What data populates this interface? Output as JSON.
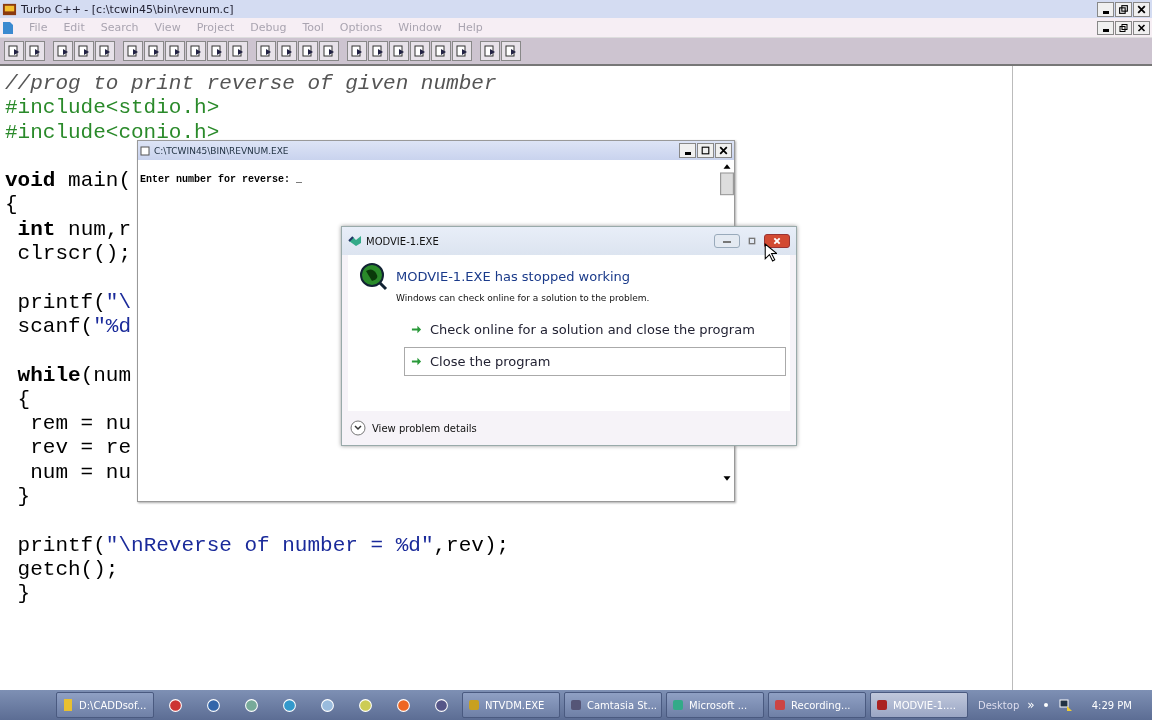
{
  "window": {
    "title": "Turbo C++ - [c:\\tcwin45\\bin\\revnum.c]"
  },
  "menu": [
    {
      "label": "File",
      "disabled": true
    },
    {
      "label": "Edit",
      "disabled": true
    },
    {
      "label": "Search",
      "disabled": true
    },
    {
      "label": "View",
      "disabled": true
    },
    {
      "label": "Project",
      "disabled": true
    },
    {
      "label": "Debug",
      "disabled": true
    },
    {
      "label": "Tool",
      "disabled": true
    },
    {
      "label": "Options",
      "disabled": true
    },
    {
      "label": "Window",
      "disabled": true
    },
    {
      "label": "Help",
      "disabled": true
    }
  ],
  "code": [
    {
      "gap_before": false,
      "segments": [
        {
          "kind": "comment",
          "text": "//prog to print reverse of given number"
        }
      ]
    },
    {
      "gap_before": false,
      "segments": [
        {
          "kind": "directive",
          "text": "#include<stdio.h>"
        }
      ]
    },
    {
      "gap_before": false,
      "segments": [
        {
          "kind": "directive",
          "text": "#include<conio.h>"
        }
      ]
    },
    {
      "gap_before": true,
      "segments": [
        {
          "kind": "keyword",
          "text": "void"
        },
        {
          "kind": "plain",
          "text": " main("
        }
      ]
    },
    {
      "gap_before": false,
      "segments": [
        {
          "kind": "plain",
          "text": "{"
        }
      ]
    },
    {
      "gap_before": false,
      "segments": [
        {
          "kind": "keyword",
          "text": " int"
        },
        {
          "kind": "plain",
          "text": " num,r"
        }
      ]
    },
    {
      "gap_before": false,
      "segments": [
        {
          "kind": "plain",
          "text": " clrscr();"
        }
      ]
    },
    {
      "gap_before": true,
      "segments": [
        {
          "kind": "plain",
          "text": " printf("
        },
        {
          "kind": "string",
          "text": "\"\\"
        }
      ]
    },
    {
      "gap_before": false,
      "segments": [
        {
          "kind": "plain",
          "text": " scanf("
        },
        {
          "kind": "string",
          "text": "\"%d"
        }
      ]
    },
    {
      "gap_before": true,
      "segments": [
        {
          "kind": "keyword",
          "text": " while"
        },
        {
          "kind": "plain",
          "text": "(num"
        }
      ]
    },
    {
      "gap_before": false,
      "segments": [
        {
          "kind": "plain",
          "text": " {"
        }
      ]
    },
    {
      "gap_before": false,
      "segments": [
        {
          "kind": "plain",
          "text": "  rem = nu"
        }
      ]
    },
    {
      "gap_before": false,
      "segments": [
        {
          "kind": "plain",
          "text": "  rev = re"
        }
      ]
    },
    {
      "gap_before": false,
      "segments": [
        {
          "kind": "plain",
          "text": "  num = nu"
        }
      ]
    },
    {
      "gap_before": false,
      "segments": [
        {
          "kind": "plain",
          "text": " }"
        }
      ]
    },
    {
      "gap_before": true,
      "segments": [
        {
          "kind": "plain",
          "text": " printf("
        },
        {
          "kind": "string",
          "text": "\"\\nReverse of number = %d\""
        },
        {
          "kind": "plain",
          "text": ",rev);"
        }
      ]
    },
    {
      "gap_before": false,
      "segments": [
        {
          "kind": "plain",
          "text": " getch();"
        }
      ]
    },
    {
      "gap_before": false,
      "segments": [
        {
          "kind": "plain",
          "text": " }"
        }
      ]
    }
  ],
  "console": {
    "title": "C:\\TCWIN45\\BIN\\REVNUM.EXE",
    "prompt": "Enter number for reverse: _"
  },
  "dialog": {
    "title": "MODVIE-1.EXE",
    "heading": "MODVIE-1.EXE has stopped working",
    "message": "Windows can check online for a solution to the problem.",
    "options": [
      {
        "label": "Check online for a solution and close the program",
        "selected": false
      },
      {
        "label": "Close the program",
        "selected": true
      }
    ],
    "details": "View problem details"
  },
  "taskbar": {
    "items": [
      {
        "label": "D:\\CADDsof...",
        "selected": false
      },
      {
        "label": "NTVDM.EXE",
        "selected": false
      },
      {
        "label": "Camtasia St...",
        "selected": false
      },
      {
        "label": "Microsoft ...",
        "selected": false
      },
      {
        "label": "Recording...",
        "selected": false
      },
      {
        "label": "MODVIE-1....",
        "selected": true
      }
    ],
    "desktop": "Desktop",
    "more": "»",
    "clock": "4:29 PM"
  }
}
